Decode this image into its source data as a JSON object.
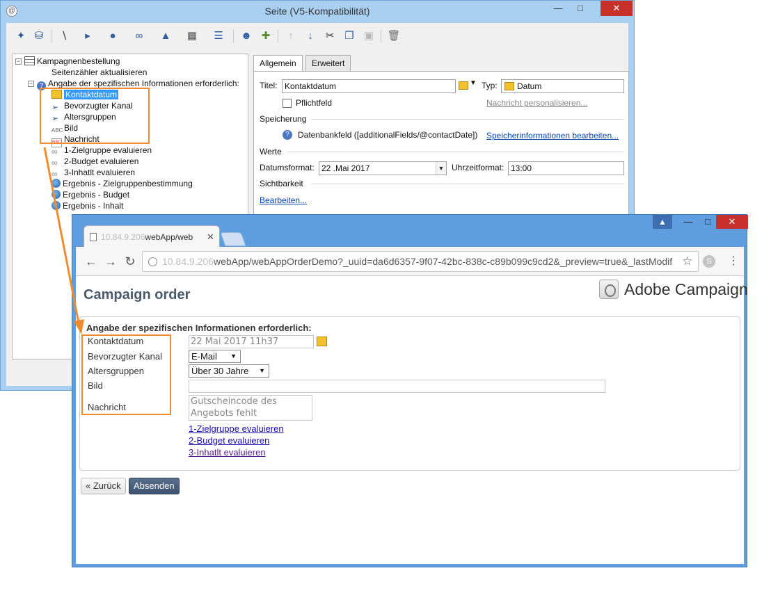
{
  "editor": {
    "title": "Seite (V5-Kompatibilität)",
    "app_icon": "@",
    "tree": {
      "root": "Kampagnenbestellung",
      "items": [
        {
          "label": "Seitenzähler aktualisieren",
          "icon": "none-icon"
        },
        {
          "label": "Angabe der spezifischen Informationen erforderlich:",
          "icon": "question-icon"
        },
        {
          "label": "Kontaktdatum",
          "icon": "calendar-icon",
          "selected": true
        },
        {
          "label": "Bevorzugter Kanal",
          "icon": "cursor-icon"
        },
        {
          "label": "Altersgruppen",
          "icon": "cursor-icon"
        },
        {
          "label": "Bild",
          "icon": "abc-icon"
        },
        {
          "label": "Nachricht",
          "icon": "message-icon"
        },
        {
          "label": "1-Zielgruppe evaluieren",
          "icon": "link-icon"
        },
        {
          "label": "2-Budget evaluieren",
          "icon": "link-icon"
        },
        {
          "label": "3-Inhatlt evaluieren",
          "icon": "link-icon"
        },
        {
          "label": "Ergebnis - Zielgruppenbestimmung",
          "icon": "globe-icon"
        },
        {
          "label": "Ergebnis - Budget",
          "icon": "globe-icon"
        },
        {
          "label": "Ergebnis - Inhalt",
          "icon": "globe-icon"
        }
      ]
    },
    "tabs": [
      "Allgemein",
      "Erweitert"
    ],
    "general": {
      "title_label": "Titel:",
      "title_value": "Kontaktdatum",
      "type_label": "Typ:",
      "type_value": "Datum",
      "mandatory_label": "Pflichtfeld",
      "personalize_link": "Nachricht personalisieren...",
      "storage_section": "Speicherung",
      "storage_value": "Datenbankfeld ([additionalFields/@contactDate])",
      "storage_link": "Speicherinformationen bearbeiten...",
      "values_section": "Werte",
      "date_format_label": "Datumsformat:",
      "date_format_value": "22 .Mai 2017",
      "time_format_label": "Uhrzeitformat:",
      "time_format_value": "13:00",
      "visibility_section": "Sichtbarkeit",
      "visibility_link": "Bearbeiten..."
    }
  },
  "browser": {
    "tab_title": "webApp/web",
    "url_host": "10.84.9.206",
    "url_path": "webApp/webAppOrderDemo?_uuid=da6d6357-9f07-42bc-838c-c89b099c9cd2&_preview=true&_lastModif",
    "page_title": "Campaign order",
    "brand": "Adobe Campaign",
    "form": {
      "section_title": "Angabe der spezifischen Informationen erforderlich:",
      "contact_date_label": "Kontaktdatum",
      "contact_date_placeholder": "22 Mai 2017 11h37",
      "channel_label": "Bevorzugter Kanal",
      "channel_value": "E-Mail",
      "age_label": "Altersgruppen",
      "age_value": "Über 30 Jahre",
      "image_label": "Bild",
      "message_label": "Nachricht",
      "message_placeholder": "Gutscheincode des Angebots fehlt",
      "links": [
        "1-Zielgruppe evaluieren",
        "2-Budget evaluieren",
        "3-Inhatlt evaluieren"
      ]
    },
    "back_button": "« Zurück",
    "submit_button": "Absenden"
  },
  "colors": {
    "highlight": "#f08c2e",
    "editor_frame": "#a9cff0",
    "browser_frame": "#5e9ee0",
    "selection": "#3399ff"
  }
}
